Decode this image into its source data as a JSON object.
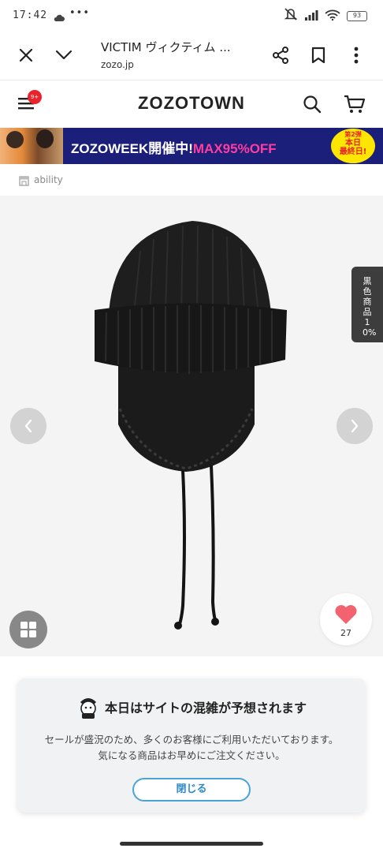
{
  "status_bar": {
    "time": "17:42",
    "dots": "•••",
    "battery": "93"
  },
  "browser": {
    "title": "VICTIM ヴィクティム ...",
    "url": "zozo.jp"
  },
  "header": {
    "logo": "ZOZOTOWN",
    "menu_badge": "9+"
  },
  "banner": {
    "text_main": "ZOZOWEEK開催中!",
    "text_accent": "MAX95%OFF",
    "badge_small": "第2弾",
    "badge_line1": "本日",
    "badge_line2": "最終日!"
  },
  "brand": {
    "name": "ability"
  },
  "product": {
    "side_tab_label": "黒色商品10%",
    "favorite_count": "27"
  },
  "notice": {
    "title": "本日はサイトの混雑が予想されます",
    "body_line1": "セールが盛況のため、多くのお客様にご利用いただいております。",
    "body_line2": "気になる商品はお早めにご注文ください。",
    "close_label": "閉じる"
  },
  "colors": {
    "banner_bg": "#1c1f7a",
    "accent_pink": "#ff3da0",
    "badge_red": "#e8232b",
    "close_blue": "#2d8acb",
    "heart": "#f2636f"
  }
}
